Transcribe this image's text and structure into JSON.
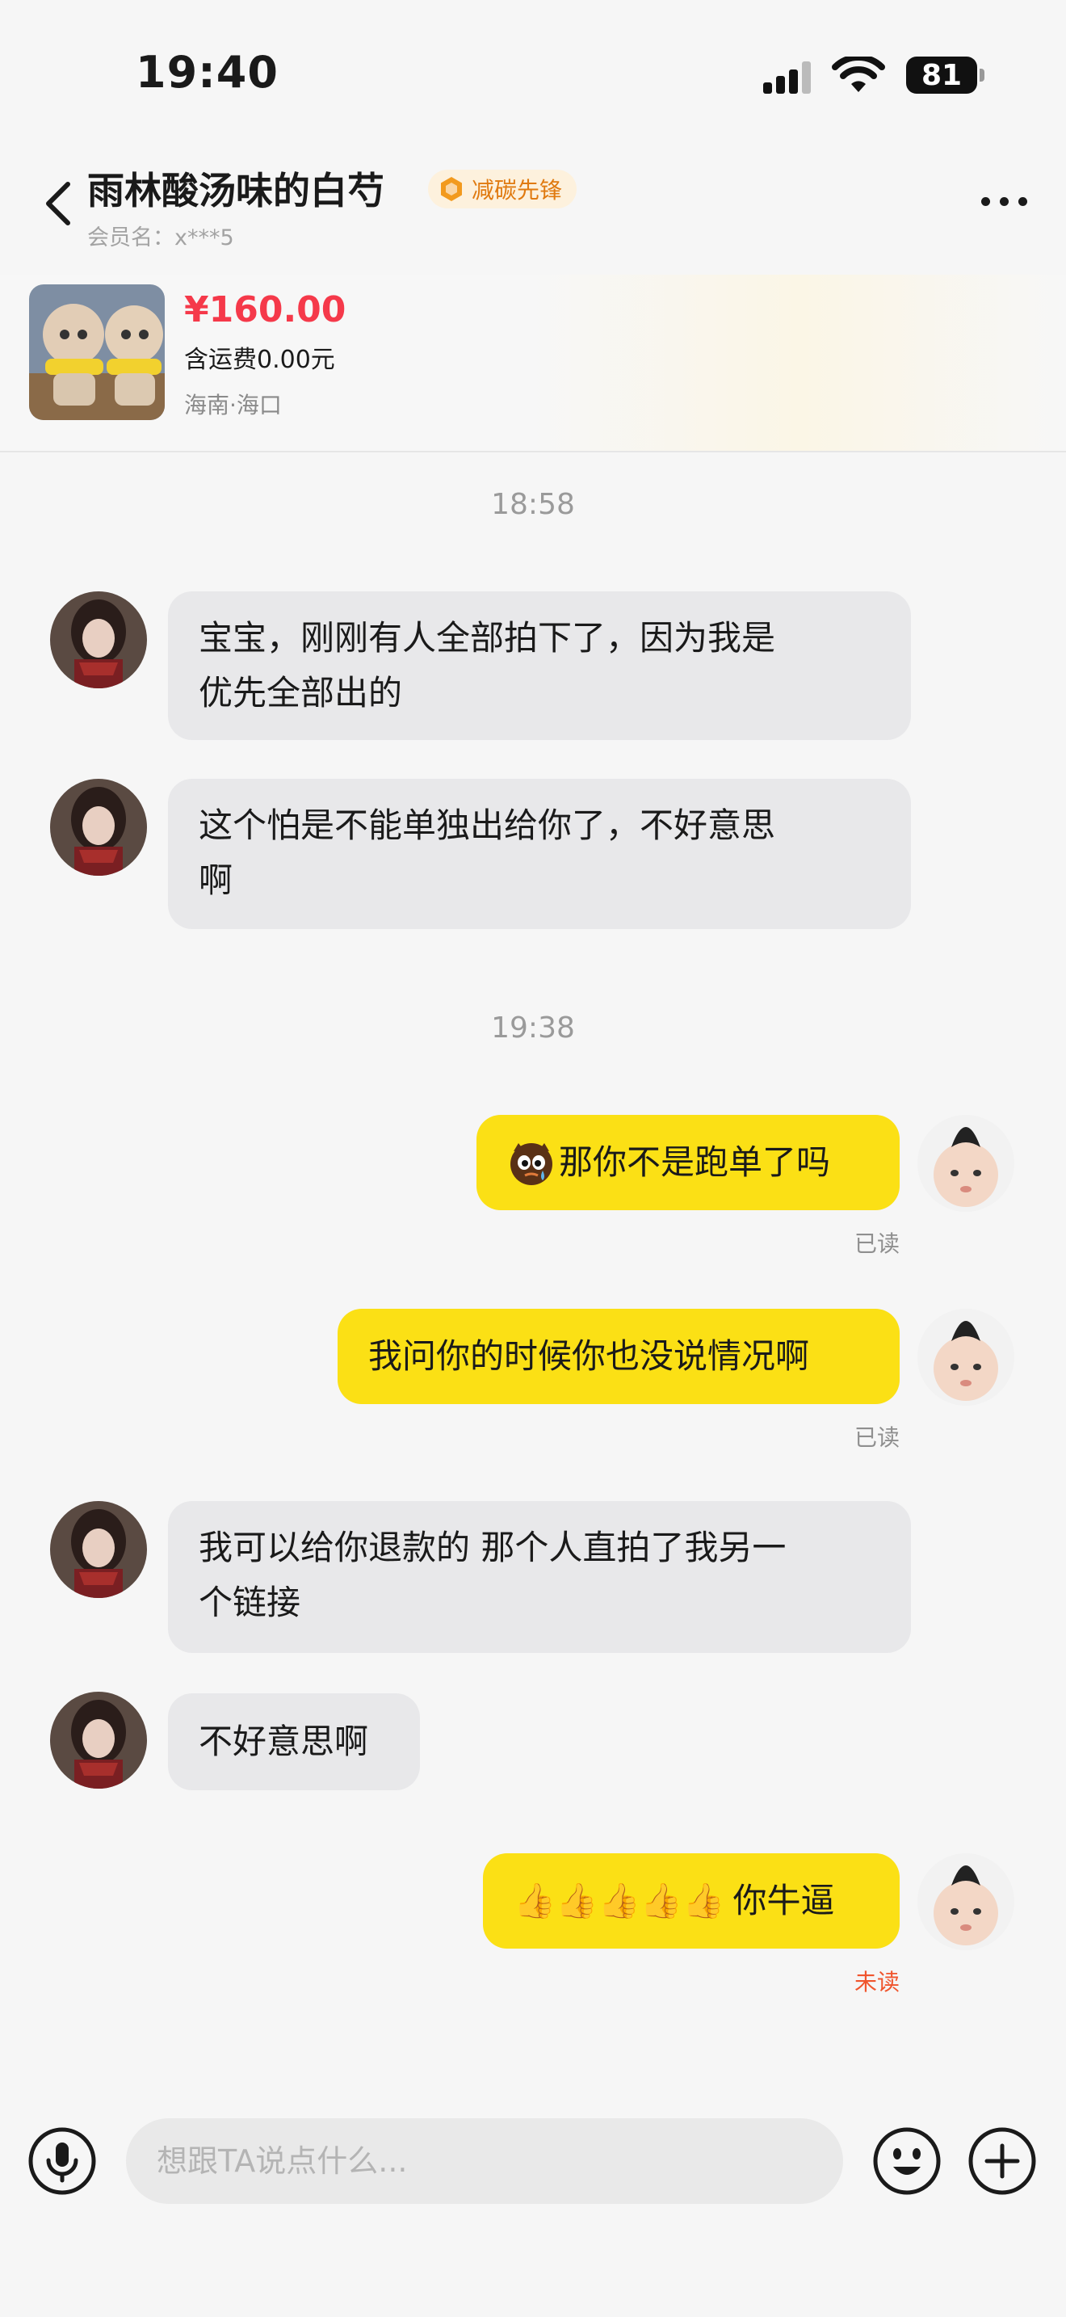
{
  "status_bar": {
    "time": "19:40",
    "battery": "81"
  },
  "header": {
    "seller_name": "雨林酸汤味的白芍",
    "badge": "减碳先锋",
    "member_label": "会员名：x***5"
  },
  "product": {
    "price": "¥160.00",
    "shipping": "含运费0.00元",
    "location": "海南·海口"
  },
  "chat": {
    "time_1": "18:58",
    "time_2": "19:38",
    "messages": [
      {
        "side": "in",
        "text": "宝宝，刚刚有人全部拍下了，因为我是\n优先全部出的"
      },
      {
        "side": "in",
        "text": "这个怕是不能单独出给你了，不好意思\n啊"
      },
      {
        "side": "out",
        "emoji": "crying-face-emoji",
        "text": "那你不是跑单了吗",
        "status": "已读"
      },
      {
        "side": "out",
        "text": "我问你的时候你也没说情况啊",
        "status": "已读"
      },
      {
        "side": "in",
        "text": "我可以给你退款的 那个人直拍了我另一\n个链接"
      },
      {
        "side": "in",
        "text": "不好意思啊"
      },
      {
        "side": "out",
        "emoji_prefix": "👍👍👍👍👍",
        "text": "你牛逼",
        "status": "未读"
      }
    ]
  },
  "input": {
    "placeholder": "想跟TA说点什么..."
  },
  "colors": {
    "outgoing_bubble": "#fbe015",
    "incoming_bubble": "#e8e8ea",
    "price": "#f5394a",
    "unread": "#f0552d",
    "badge_text": "#e07a10"
  }
}
